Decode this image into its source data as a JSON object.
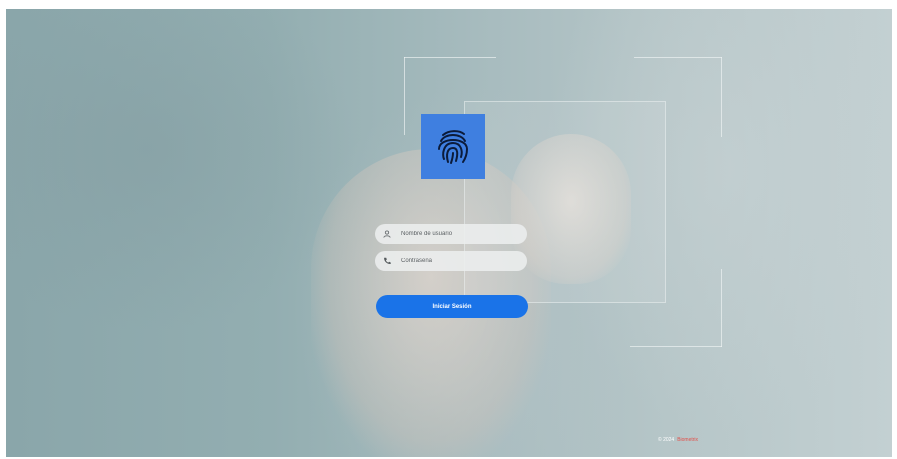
{
  "form": {
    "username_placeholder": "Nombre de usuario",
    "password_placeholder": "Contraseña",
    "login_label": "Iniciar Sesión"
  },
  "footer": {
    "prefix": "© 2024",
    "brand": "Biometrix"
  },
  "colors": {
    "accent": "#1a73e8",
    "logo_tile": "#3f7fe0",
    "footer_brand": "#e2504a"
  },
  "icons": {
    "logo": "fingerprint-icon",
    "username": "user-icon",
    "password": "phone-icon"
  }
}
